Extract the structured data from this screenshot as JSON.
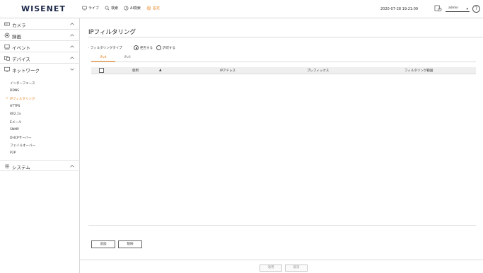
{
  "app": {
    "logo": "WISENET"
  },
  "topmenu": [
    {
      "icon": "monitor-icon",
      "label": "ライブ",
      "active": false
    },
    {
      "icon": "search-icon",
      "label": "検索",
      "active": false
    },
    {
      "icon": "ai-search-icon",
      "label": "AI検索",
      "active": false
    },
    {
      "icon": "gear-icon",
      "label": "設定",
      "active": true
    }
  ],
  "header": {
    "datetime": "2020-07-28 19:21:09",
    "user": "admin",
    "help": "?"
  },
  "sidebar": {
    "sections": [
      {
        "label": "カメラ",
        "icon": "camera-icon",
        "expanded": false
      },
      {
        "label": "録画",
        "icon": "record-icon",
        "expanded": false
      },
      {
        "label": "イベント",
        "icon": "event-icon",
        "expanded": false
      },
      {
        "label": "デバイス",
        "icon": "device-icon",
        "expanded": false
      },
      {
        "label": "ネットワーク",
        "icon": "network-icon",
        "expanded": true
      },
      {
        "label": "システム",
        "icon": "system-icon",
        "expanded": false
      }
    ],
    "network_items": [
      {
        "label": "インターフェース",
        "active": false
      },
      {
        "label": "DDNS",
        "active": false
      },
      {
        "label": "IPフィルタリング",
        "active": true
      },
      {
        "label": "HTTPS",
        "active": false
      },
      {
        "label": "802.1x",
        "active": false
      },
      {
        "label": "Eメール",
        "active": false
      },
      {
        "label": "SNMP",
        "active": false
      },
      {
        "label": "DHCPサーバー",
        "active": false
      },
      {
        "label": "フェイルオーバー",
        "active": false
      },
      {
        "label": "P2P",
        "active": false
      }
    ],
    "active_marker": ">"
  },
  "main": {
    "title": "IPフィルタリング",
    "filter_type_label": "· フィルタリングタイプ",
    "radio_deny": "拒否する",
    "radio_allow": "許可する",
    "selected": "拒否する",
    "tabs": [
      {
        "label": "IPv4",
        "active": true
      },
      {
        "label": "IPv6",
        "active": false
      }
    ],
    "table": {
      "columns": [
        "使用",
        "IPアドレス",
        "プレフィックス",
        "フィルタリング範囲"
      ],
      "sort_indicator": "▲",
      "rows": []
    },
    "add_button": "追加",
    "delete_button": "削除"
  },
  "footer": {
    "apply_button": "適用",
    "cancel_button": "取消"
  },
  "colors": {
    "accent": "#e8821e",
    "text": "#333333",
    "border": "#d8d8d8"
  }
}
